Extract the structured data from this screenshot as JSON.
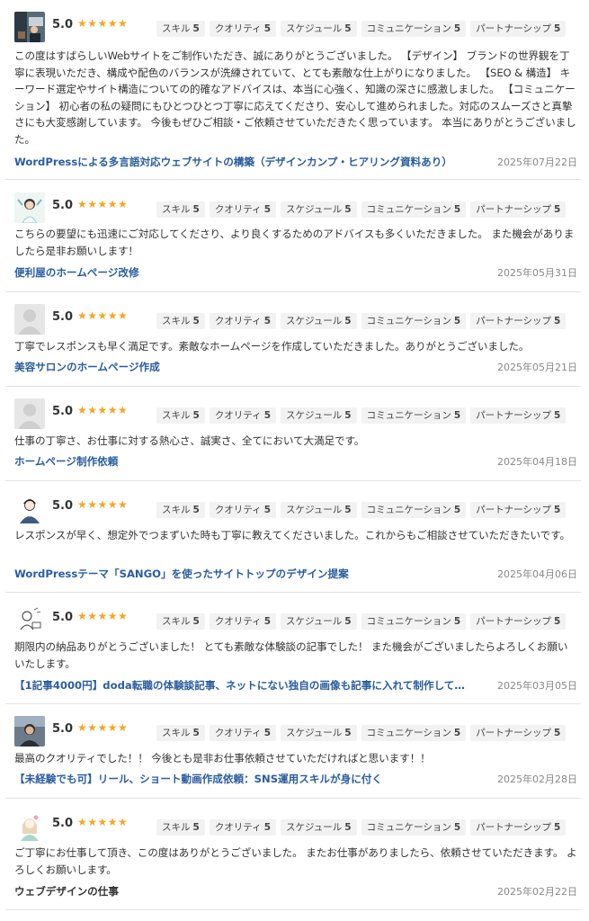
{
  "stars": "★★★★★",
  "tag_labels": [
    "スキル",
    "クオリティ",
    "スケジュール",
    "コミュニケーション",
    "パートナーシップ"
  ],
  "reviews": [
    {
      "score": "5.0",
      "tag_values": [
        "5",
        "5",
        "5",
        "5",
        "5"
      ],
      "avatar_icon": "office-photo-avatar-icon",
      "text": "この度はすばらしいWebサイトをご制作いただき、誠にありがとうございました。 【デザイン】 ブランドの世界観を丁寧に表現いただき、構成や配色のバランスが洗練されていて、とても素敵な仕上がりになりました。 【SEO & 構造】 キーワード選定やサイト構造についての的確なアドバイスは、本当に心強く、知識の深さに感激しました。 【コミュニケーション】 初心者の私の疑問にもひとつひとつ丁寧に応えてくださり、安心して進められました。対応のスムーズさと真摯さにも大変感謝しています。 今後もぜひご相談・ご依頼させていただきたく思っています。 本当にありがとうございました。",
      "title": "WordPressによる多言語対応ウェブサイトの構築（デザインカンプ・ヒアリング資料あり）",
      "date": "2025年07月22日"
    },
    {
      "score": "5.0",
      "tag_values": [
        "5",
        "5",
        "5",
        "5",
        "5"
      ],
      "avatar_icon": "woman-illustration-avatar-icon",
      "text": "こちらの要望にも迅速にご対応してくださり、より良くするためのアドバイスも多くいただきました。 また機会がありましたら是非お願いします！",
      "title": "便利屋のホームページ改修",
      "date": "2025年05月31日"
    },
    {
      "score": "5.0",
      "tag_values": [
        "5",
        "5",
        "5",
        "5",
        "5"
      ],
      "avatar_icon": "default-user-avatar-icon",
      "text": "丁寧でレスポンスも早く満足です。素敵なホームページを作成していただきました。ありがとうございました。",
      "title": "美容サロンのホームページ作成",
      "date": "2025年05月21日"
    },
    {
      "score": "5.0",
      "tag_values": [
        "5",
        "5",
        "5",
        "5",
        "5"
      ],
      "avatar_icon": "default-user-avatar-icon",
      "text": "仕事の丁寧さ、お仕事に対する熱心さ、誠実さ、全てにおいて大満足です。",
      "title": "ホームページ制作依頼",
      "date": "2025年04月18日"
    },
    {
      "score": "5.0",
      "tag_values": [
        "5",
        "5",
        "5",
        "5",
        "5"
      ],
      "avatar_icon": "man-illustration-avatar-icon",
      "text": "レスポンスが早く、想定外でつまずいた時も丁寧に教えてくださいました。これからもご相談させていただきたいです。",
      "title": "WordPressテーマ「SANGO」を使ったサイトトップのデザイン提案",
      "date": "2025年04月06日"
    },
    {
      "score": "5.0",
      "tag_values": [
        "5",
        "5",
        "5",
        "5",
        "5"
      ],
      "avatar_icon": "sketch-person-avatar-icon",
      "text": "期限内の納品ありがとうございました！ とても素敵な体験談の記事でした！ また機会がございましたらよろしくお願いいたします。",
      "title": "【1記事4000円】doda転職の体験談記事、ネットにない独自の画像も記事に入れて制作して…",
      "date": "2025年03月05日"
    },
    {
      "score": "5.0",
      "tag_values": [
        "5",
        "5",
        "5",
        "5",
        "5"
      ],
      "avatar_icon": "photo-portrait-avatar-icon",
      "text": "最高のクオリティでした！！ 今後とも是非お仕事依頼させていただければと思います！！",
      "title": "【未経験でも可】リール、ショート動画作成依頼：SNS運用スキルが身に付く",
      "date": "2025年02月28日"
    },
    {
      "score": "5.0",
      "tag_values": [
        "5",
        "5",
        "5",
        "5",
        "5"
      ],
      "avatar_icon": "girl-illustration-avatar-icon",
      "text": "ご丁寧にお仕事して頂き、この度はありがとうございました。 またお仕事がありましたら、依頼させていただきます。 よろしくお願いします。",
      "title": "ウェブデザインの仕事",
      "date": "2025年02月22日"
    }
  ]
}
